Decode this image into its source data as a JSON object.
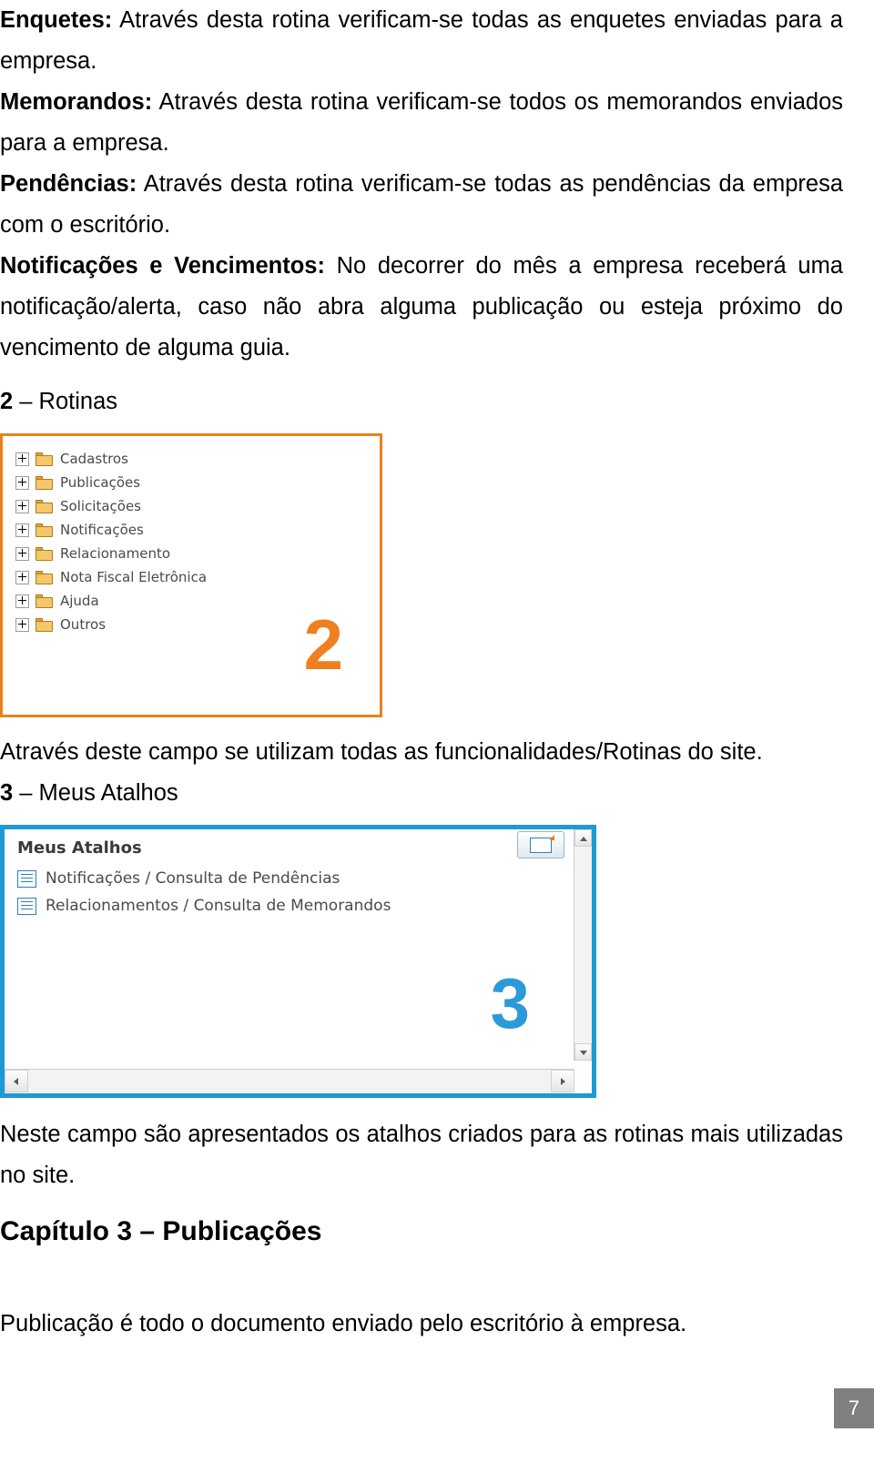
{
  "document": {
    "paragraphs": [
      {
        "label": "Enquetes:",
        "text": " Através desta rotina verificam-se todas as enquetes enviadas para a empresa."
      },
      {
        "label": "Memorandos:",
        "text": " Através desta rotina verificam-se todos os memorandos enviados para a empresa."
      },
      {
        "label": "Pendências:",
        "text": " Através desta rotina verificam-se todas as pendências da empresa com o escritório."
      },
      {
        "label": "Notificações e Vencimentos:",
        "text": " No decorrer do mês a empresa receberá uma notificação/alerta, caso não abra alguma publicação ou esteja próximo do vencimento de alguma guia."
      }
    ],
    "section_rotinas": {
      "number": "2",
      "dash": " – ",
      "title": "Rotinas",
      "caption": "Através deste campo se utilizam todas as funcionalidades/Rotinas do site."
    },
    "section_atalhos": {
      "number": "3",
      "dash": " – ",
      "title": "Meus Atalhos",
      "caption": "Neste campo são apresentados os atalhos criados para as rotinas mais utilizadas no site."
    },
    "chapter_title": "Capítulo 3 – Publicações",
    "closing_paragraph": "Publicação é todo o documento enviado pelo escritório à empresa.",
    "page_number": "7"
  },
  "screenshot_rotinas": {
    "badge": "2",
    "tree_items": [
      {
        "label": "Cadastros"
      },
      {
        "label": "Publicações"
      },
      {
        "label": "Solicitações"
      },
      {
        "label": "Notificações"
      },
      {
        "label": "Relacionamento"
      },
      {
        "label": "Nota Fiscal Eletrônica"
      },
      {
        "label": "Ajuda"
      },
      {
        "label": "Outros"
      }
    ],
    "border_color": "#E8821A",
    "badge_color": "#F07F21"
  },
  "screenshot_atalhos": {
    "badge": "3",
    "title": "Meus Atalhos",
    "items": [
      {
        "label": "Notificações / Consulta de Pendências"
      },
      {
        "label": "Relacionamentos / Consulta de Memorandos"
      }
    ],
    "border_color": "#1C9AD6",
    "badge_color": "#2B9BD8"
  }
}
